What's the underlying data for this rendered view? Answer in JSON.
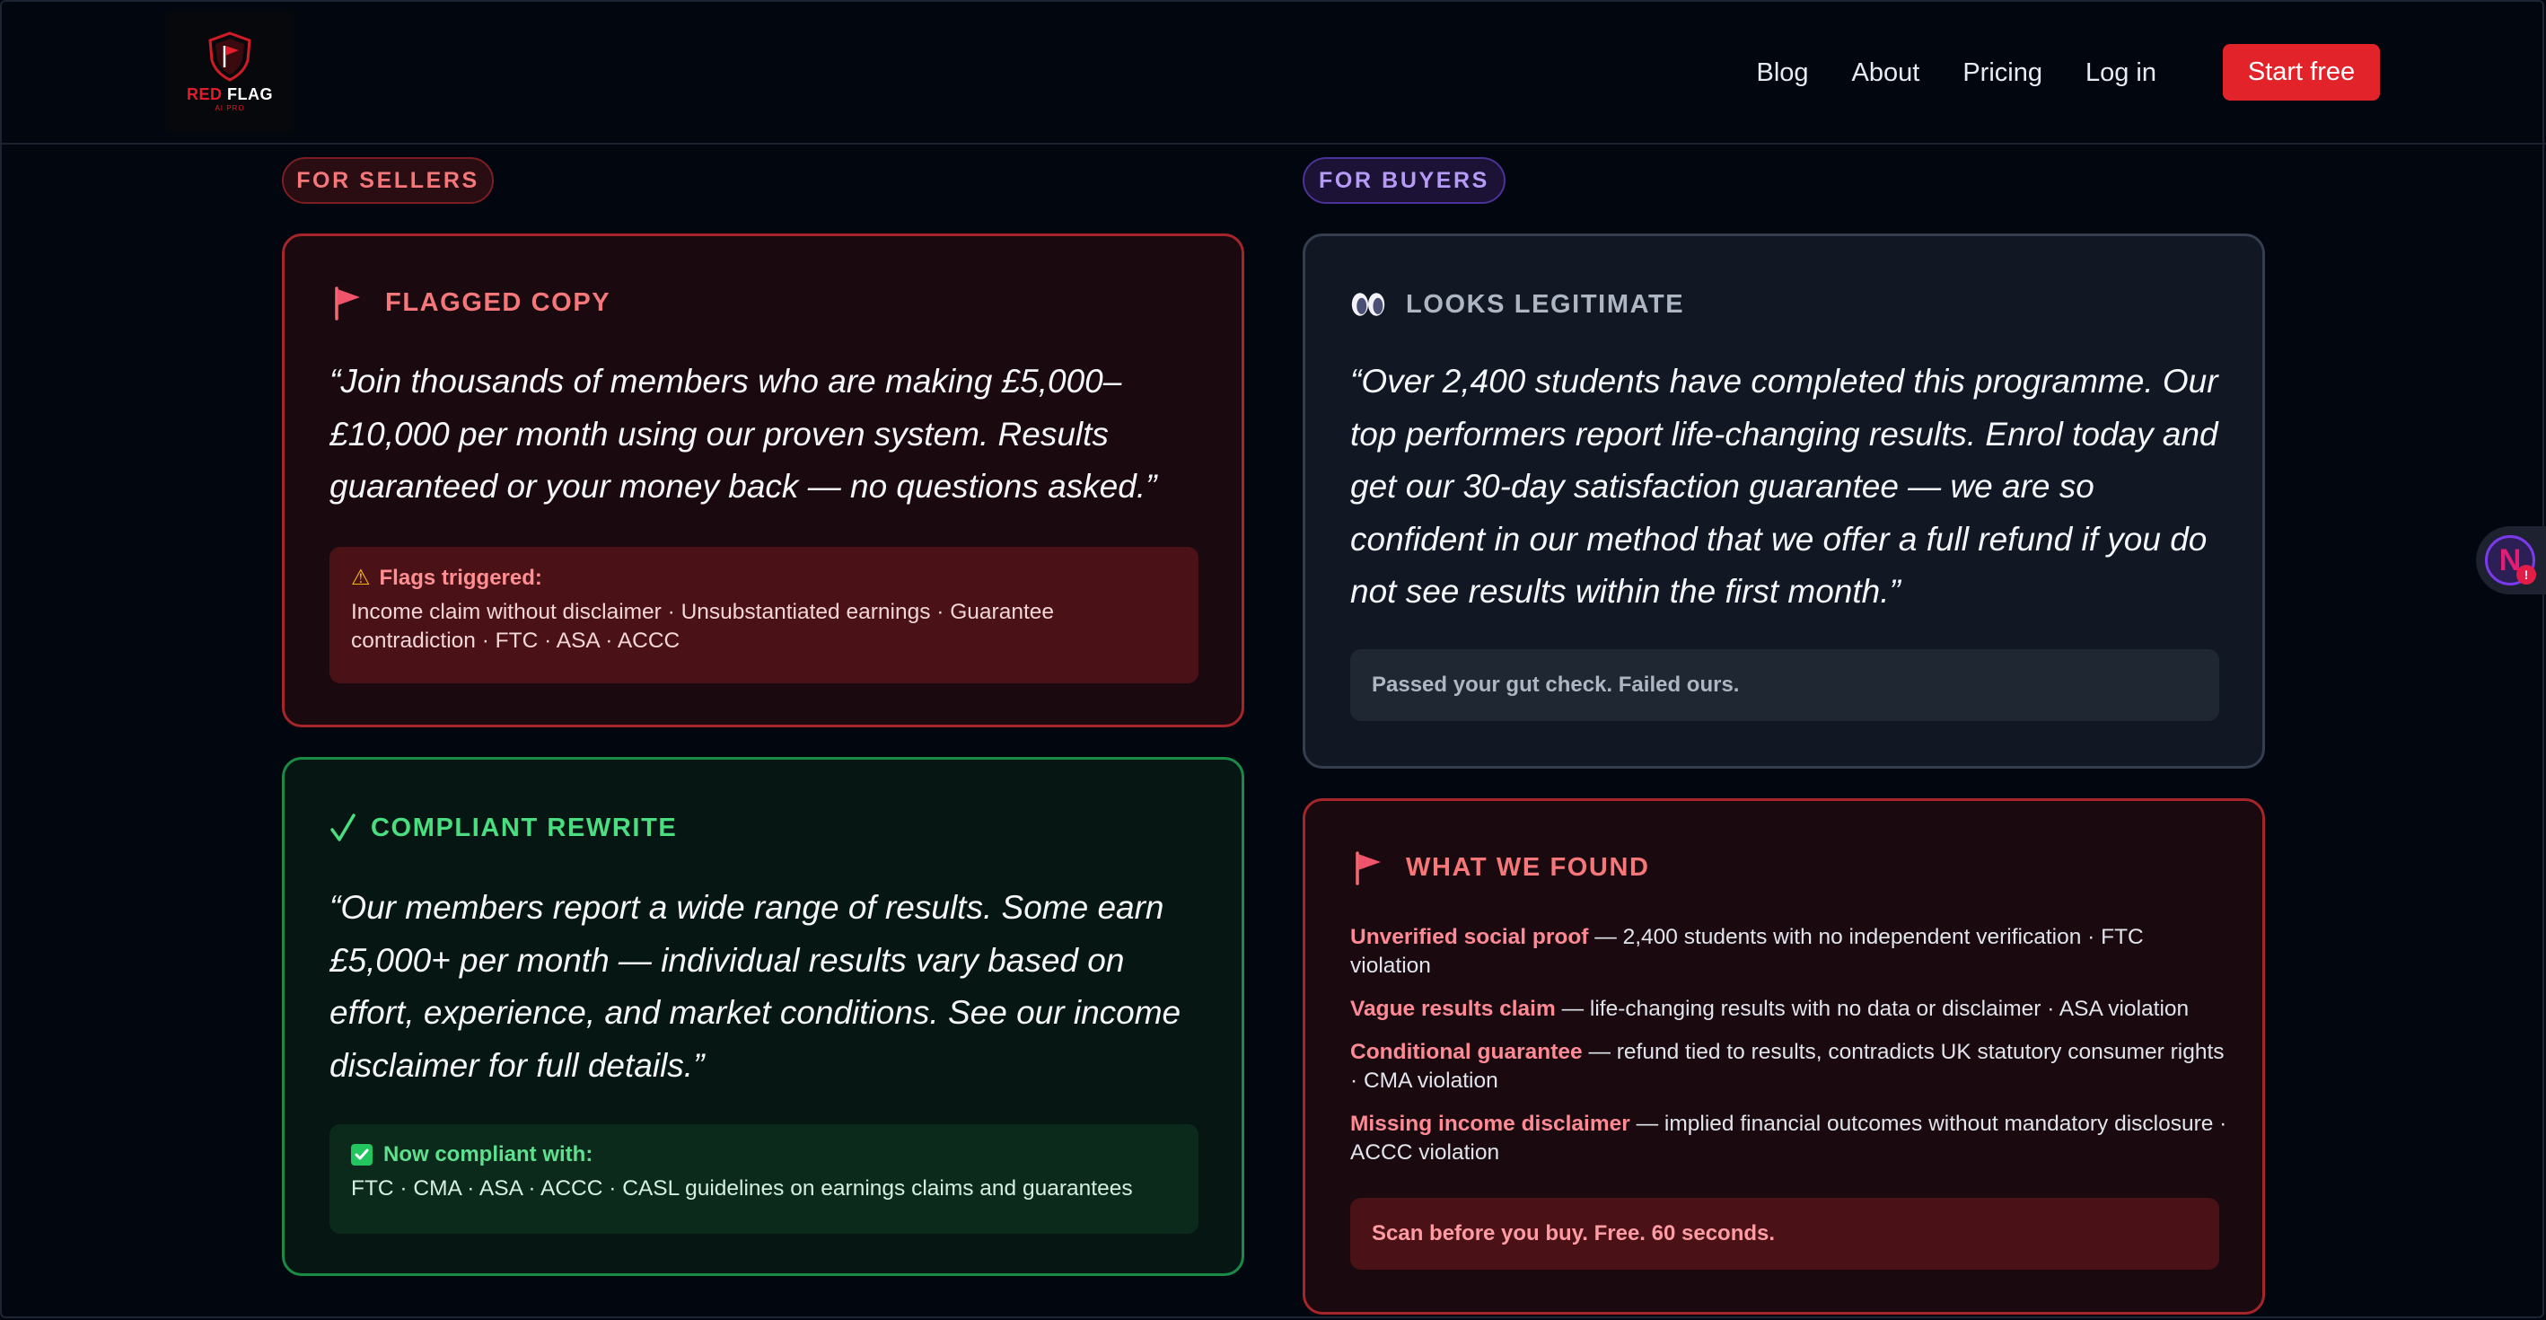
{
  "nav": {
    "logo_text_red": "RED",
    "logo_text_white": "FLAG",
    "logo_sub": "AI PRO",
    "links": [
      "Blog",
      "About",
      "Pricing",
      "Log in"
    ],
    "cta": "Start free"
  },
  "tags": {
    "sellers": "FOR SELLERS",
    "buyers": "FOR BUYERS"
  },
  "flagged": {
    "title": "FLAGGED COPY",
    "quote": "“Join thousands of members who are making £5,000–£10,000 per month using our proven system. Results guaranteed or your money back — no questions asked.”",
    "box_title": "Flags triggered:",
    "box_text": "Income claim without disclaimer · Unsubstantiated earnings · Guarantee contradiction · FTC · ASA · ACCC"
  },
  "compliant": {
    "title": "COMPLIANT REWRITE",
    "quote": "“Our members report a wide range of results. Some earn £5,000+ per month — individual results vary based on effort, experience, and market conditions. See our income disclaimer for full details.”",
    "box_title": "Now compliant with:",
    "box_text": "FTC · CMA · ASA · ACCC · CASL guidelines on earnings claims and guarantees"
  },
  "legit": {
    "title": "LOOKS LEGITIMATE",
    "quote": "“Over 2,400 students have completed this programme. Our top performers report life-changing results. Enrol today and get our 30-day satisfaction guarantee — we are so confident in our method that we offer a full refund if you do not see results within the first month.”",
    "box_text": "Passed your gut check. Failed ours."
  },
  "found": {
    "title": "WHAT WE FOUND",
    "items": [
      {
        "key": "Unverified social proof",
        "text": " — 2,400 students with no independent verification · FTC violation"
      },
      {
        "key": "Vague results claim",
        "text": " — life-changing results with no data or disclaimer · ASA violation"
      },
      {
        "key": "Conditional guarantee",
        "text": " — refund tied to results, contradicts UK statutory consumer rights · CMA violation"
      },
      {
        "key": "Missing income disclaimer",
        "text": " — implied financial outcomes without mandatory disclosure · ACCC violation"
      }
    ],
    "box_text": "Scan before you buy. Free. 60 seconds."
  },
  "side_badge": {
    "letter": "N",
    "dot": "!"
  },
  "colors": {
    "accent_red": "#e3232a",
    "flag_text": "#f5777a",
    "green_text": "#4ade80",
    "buyers_purple": "#b69af8"
  }
}
